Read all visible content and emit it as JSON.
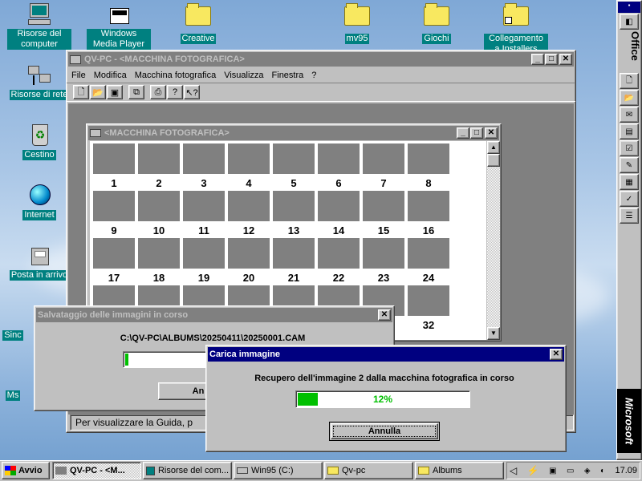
{
  "desktop": {
    "icons": [
      {
        "label": "Risorse del computer"
      },
      {
        "label": "Windows Media Player"
      },
      {
        "label": "Creative"
      },
      {
        "label": "mv95"
      },
      {
        "label": "Giochi"
      },
      {
        "label": "Collegamento a Installers"
      },
      {
        "label": "Risorse di rete"
      },
      {
        "label": "Cestino"
      },
      {
        "label": "Internet"
      },
      {
        "label": "Posta in arrivo"
      },
      {
        "label": "Sinc"
      },
      {
        "label": "Ms"
      }
    ]
  },
  "main_window": {
    "title": "QV-PC - <MACCHINA FOTOGRAFICA>",
    "menu": [
      "File",
      "Modifica",
      "Macchina fotografica",
      "Visualizza",
      "Finestra",
      "?"
    ],
    "status": "Per visualizzare la Guida, p"
  },
  "child_window": {
    "title": "<MACCHINA FOTOGRAFICA>",
    "thumbnails": [
      "1",
      "2",
      "3",
      "4",
      "5",
      "6",
      "7",
      "8",
      "9",
      "10",
      "11",
      "12",
      "13",
      "14",
      "15",
      "16",
      "17",
      "18",
      "19",
      "20",
      "21",
      "22",
      "23",
      "24",
      "32"
    ]
  },
  "save_dialog": {
    "title": "Salvataggio delle immagini in corso",
    "path": "C:\\QV-PC\\ALBUMS\\20250411\\20250001.CAM",
    "button": "An"
  },
  "load_dialog": {
    "title": "Carica immagine",
    "message": "Recupero dell'immagine 2 dalla macchina fotografica in corso",
    "progress": 0.12,
    "progress_label": "12%",
    "cancel": "Annulla",
    "accent": "#00c000"
  },
  "taskbar": {
    "start": "Avvio",
    "tasks": [
      "QV-PC - <M...",
      "Risorse del com...",
      "Win95 (C:)",
      "Qv-pc",
      "Albums"
    ],
    "clock": "17.09"
  },
  "office_bar": {
    "label": "Office",
    "brand": "Microsoft"
  }
}
